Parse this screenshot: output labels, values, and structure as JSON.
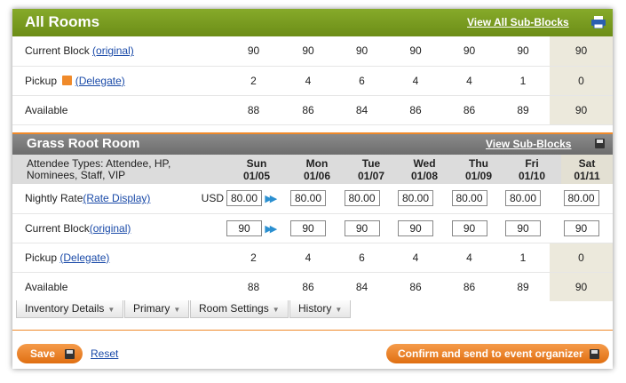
{
  "all_rooms": {
    "title": "All Rooms",
    "view_all_link": "View All Sub-Blocks",
    "rows": [
      {
        "label": "Current Block",
        "link": "(original)",
        "values": [
          "90",
          "90",
          "90",
          "90",
          "90",
          "90",
          "90"
        ]
      },
      {
        "label": "Pickup",
        "link": "(Delegate)",
        "values": [
          "2",
          "4",
          "6",
          "4",
          "4",
          "1",
          "0"
        ]
      },
      {
        "label": "Available",
        "link": "",
        "values": [
          "88",
          "86",
          "84",
          "86",
          "86",
          "89",
          "90"
        ]
      }
    ]
  },
  "grass_root": {
    "title": "Grass Root Room",
    "view_link": "View Sub-Blocks",
    "attendee_types": "Attendee Types: Attendee, HP, Nominees, Staff, VIP",
    "days": [
      {
        "name": "Sun",
        "date": "01/05"
      },
      {
        "name": "Mon",
        "date": "01/06"
      },
      {
        "name": "Tue",
        "date": "01/07"
      },
      {
        "name": "Wed",
        "date": "01/08"
      },
      {
        "name": "Thu",
        "date": "01/09"
      },
      {
        "name": "Fri",
        "date": "01/10"
      },
      {
        "name": "Sat",
        "date": "01/11"
      }
    ],
    "nightly_rate_label": "Nightly Rate",
    "rate_display_link": "(Rate Display)",
    "currency": "USD",
    "rates": [
      "80.00",
      "80.00",
      "80.00",
      "80.00",
      "80.00",
      "80.00",
      "80.00"
    ],
    "current_block_label": "Current Block",
    "original_link": "(original)",
    "blocks": [
      "90",
      "90",
      "90",
      "90",
      "90",
      "90",
      "90"
    ],
    "pickup_label": "Pickup",
    "delegate_link": "(Delegate)",
    "pickup": [
      "2",
      "4",
      "6",
      "4",
      "4",
      "1",
      "0"
    ],
    "available_label": "Available",
    "available": [
      "88",
      "86",
      "84",
      "86",
      "86",
      "89",
      "90"
    ]
  },
  "tabs": [
    "Inventory Details",
    "Primary",
    "Room Settings",
    "History"
  ],
  "footer": {
    "save": "Save",
    "reset": "Reset",
    "confirm": "Confirm and send to event organizer"
  }
}
